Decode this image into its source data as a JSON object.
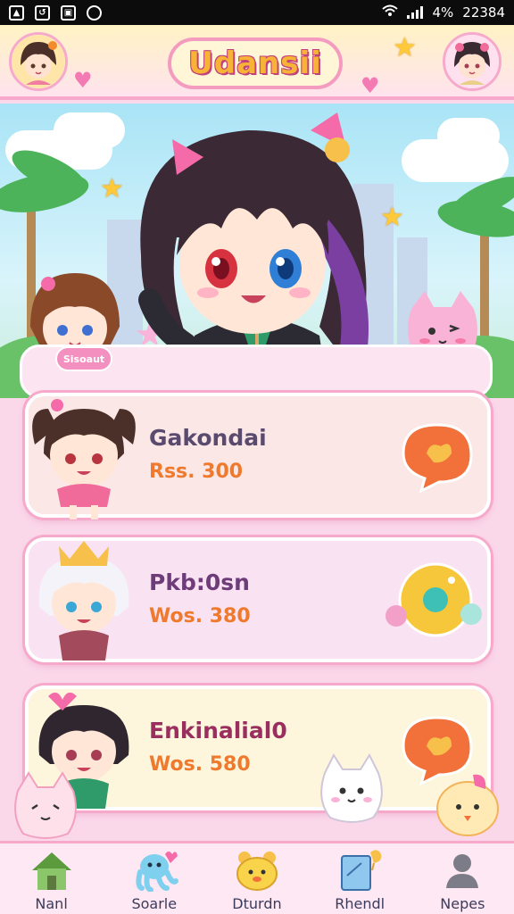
{
  "status_bar": {
    "battery_text": "4%",
    "time": "22384"
  },
  "header": {
    "title": "Udansii",
    "left_avatar": "girl-avatar-icon",
    "right_avatar": "girl-avatar-icon"
  },
  "hero": {
    "badge_text": "Sisoaut"
  },
  "cards": [
    {
      "name": "Gakondai",
      "price": "Rss. 300",
      "name_color": "#5a4a6e",
      "bg": "#fbe7e6",
      "action_icon": "chat-bubble-icon"
    },
    {
      "name": "Pkb:0sn",
      "price": "Wos. 380",
      "name_color": "#6f3c7a",
      "bg": "#f9e3f3",
      "action_icon": "game-controller-icon"
    },
    {
      "name": "Enkinalial0",
      "price": "Wos. 580",
      "name_color": "#9a2f5f",
      "bg": "#fdf6dc",
      "action_icon": "chat-bubble-icon"
    }
  ],
  "nav": [
    {
      "label": "Nanl",
      "icon": "home-icon"
    },
    {
      "label": "Soarle",
      "icon": "octopus-icon"
    },
    {
      "label": "Dturdn",
      "icon": "bear-icon"
    },
    {
      "label": "Rhendl",
      "icon": "book-icon"
    },
    {
      "label": "Nepes",
      "icon": "profile-icon"
    }
  ],
  "colors": {
    "accent_pink": "#f7a9cc",
    "title_yellow": "#f6b335",
    "price_orange": "#ef7a2e"
  }
}
